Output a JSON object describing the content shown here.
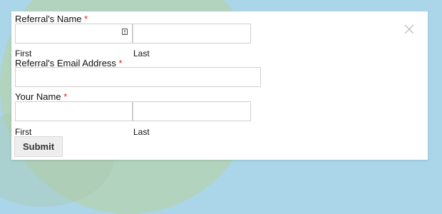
{
  "form": {
    "referral_name": {
      "label": "Referral's Name",
      "required_mark": "*",
      "first_sublabel": "First",
      "last_sublabel": "Last",
      "first_value": "",
      "last_value": ""
    },
    "referral_email": {
      "label": "Referral's Email Address",
      "required_mark": "*",
      "value": ""
    },
    "your_name": {
      "label": "Your Name",
      "required_mark": "*",
      "first_sublabel": "First",
      "last_sublabel": "Last",
      "first_value": "",
      "last_value": ""
    },
    "submit_label": "Submit"
  },
  "icons": {
    "close": "close-icon",
    "autofill": "contact-card-icon"
  },
  "colors": {
    "required": "#e02020",
    "page_background": "#abd6ea",
    "decor_circle": "#b2d3bd",
    "panel": "#ffffff",
    "button": "#eeeeee"
  }
}
